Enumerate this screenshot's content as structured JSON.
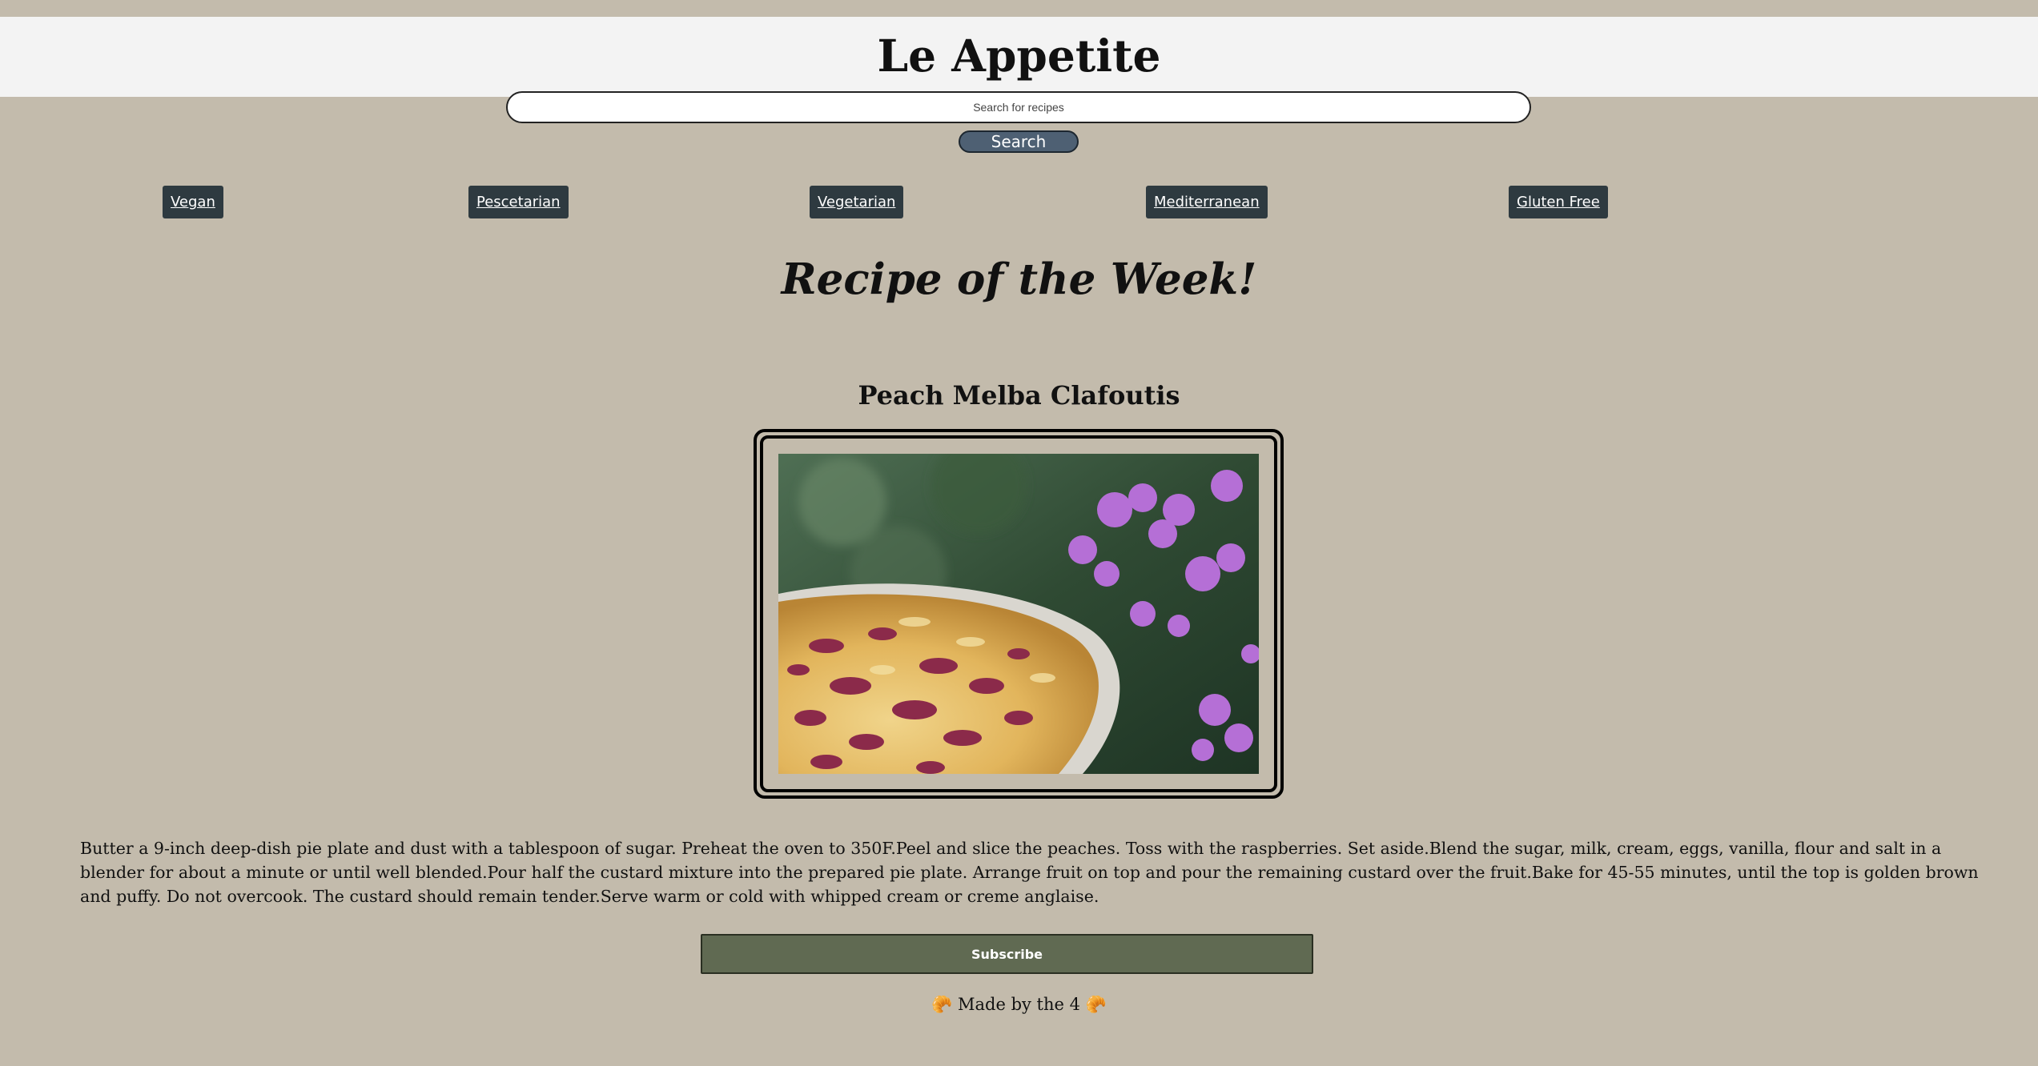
{
  "header": {
    "title": "Le Appetite"
  },
  "search": {
    "placeholder": "Search for recipes",
    "button_label": "Search"
  },
  "categories": [
    {
      "label": "Vegan"
    },
    {
      "label": "Pescetarian"
    },
    {
      "label": "Vegetarian"
    },
    {
      "label": "Mediterranean"
    },
    {
      "label": "Gluten Free"
    }
  ],
  "main": {
    "heading": "Recipe of the Week!",
    "recipe_name": "Peach Melba Clafoutis",
    "instructions": "Butter a 9-inch deep-dish pie plate and dust with a tablespoon of sugar. Preheat the oven to 350F.Peel and slice the peaches. Toss with the raspberries. Set aside.Blend the sugar, milk, cream, eggs, vanilla, flour and salt in a blender for about a minute or until well blended.Pour half the custard mixture into the prepared pie plate. Arrange fruit on top and pour the remaining custard over the fruit.Bake for 45-55 minutes, until the top is golden brown and puffy. Do not overcook. The custard should remain tender.Serve warm or cold with whipped cream or creme anglaise."
  },
  "subscribe": {
    "label": "Subscribe"
  },
  "footer": {
    "text": "🥐 Made by the 4 🥐"
  },
  "colors": {
    "background": "#c3bbac",
    "header_bg": "#f3f3f3",
    "search_button": "#4e6073",
    "category_bg": "#2e3a40",
    "subscribe_bg": "#606a52"
  }
}
